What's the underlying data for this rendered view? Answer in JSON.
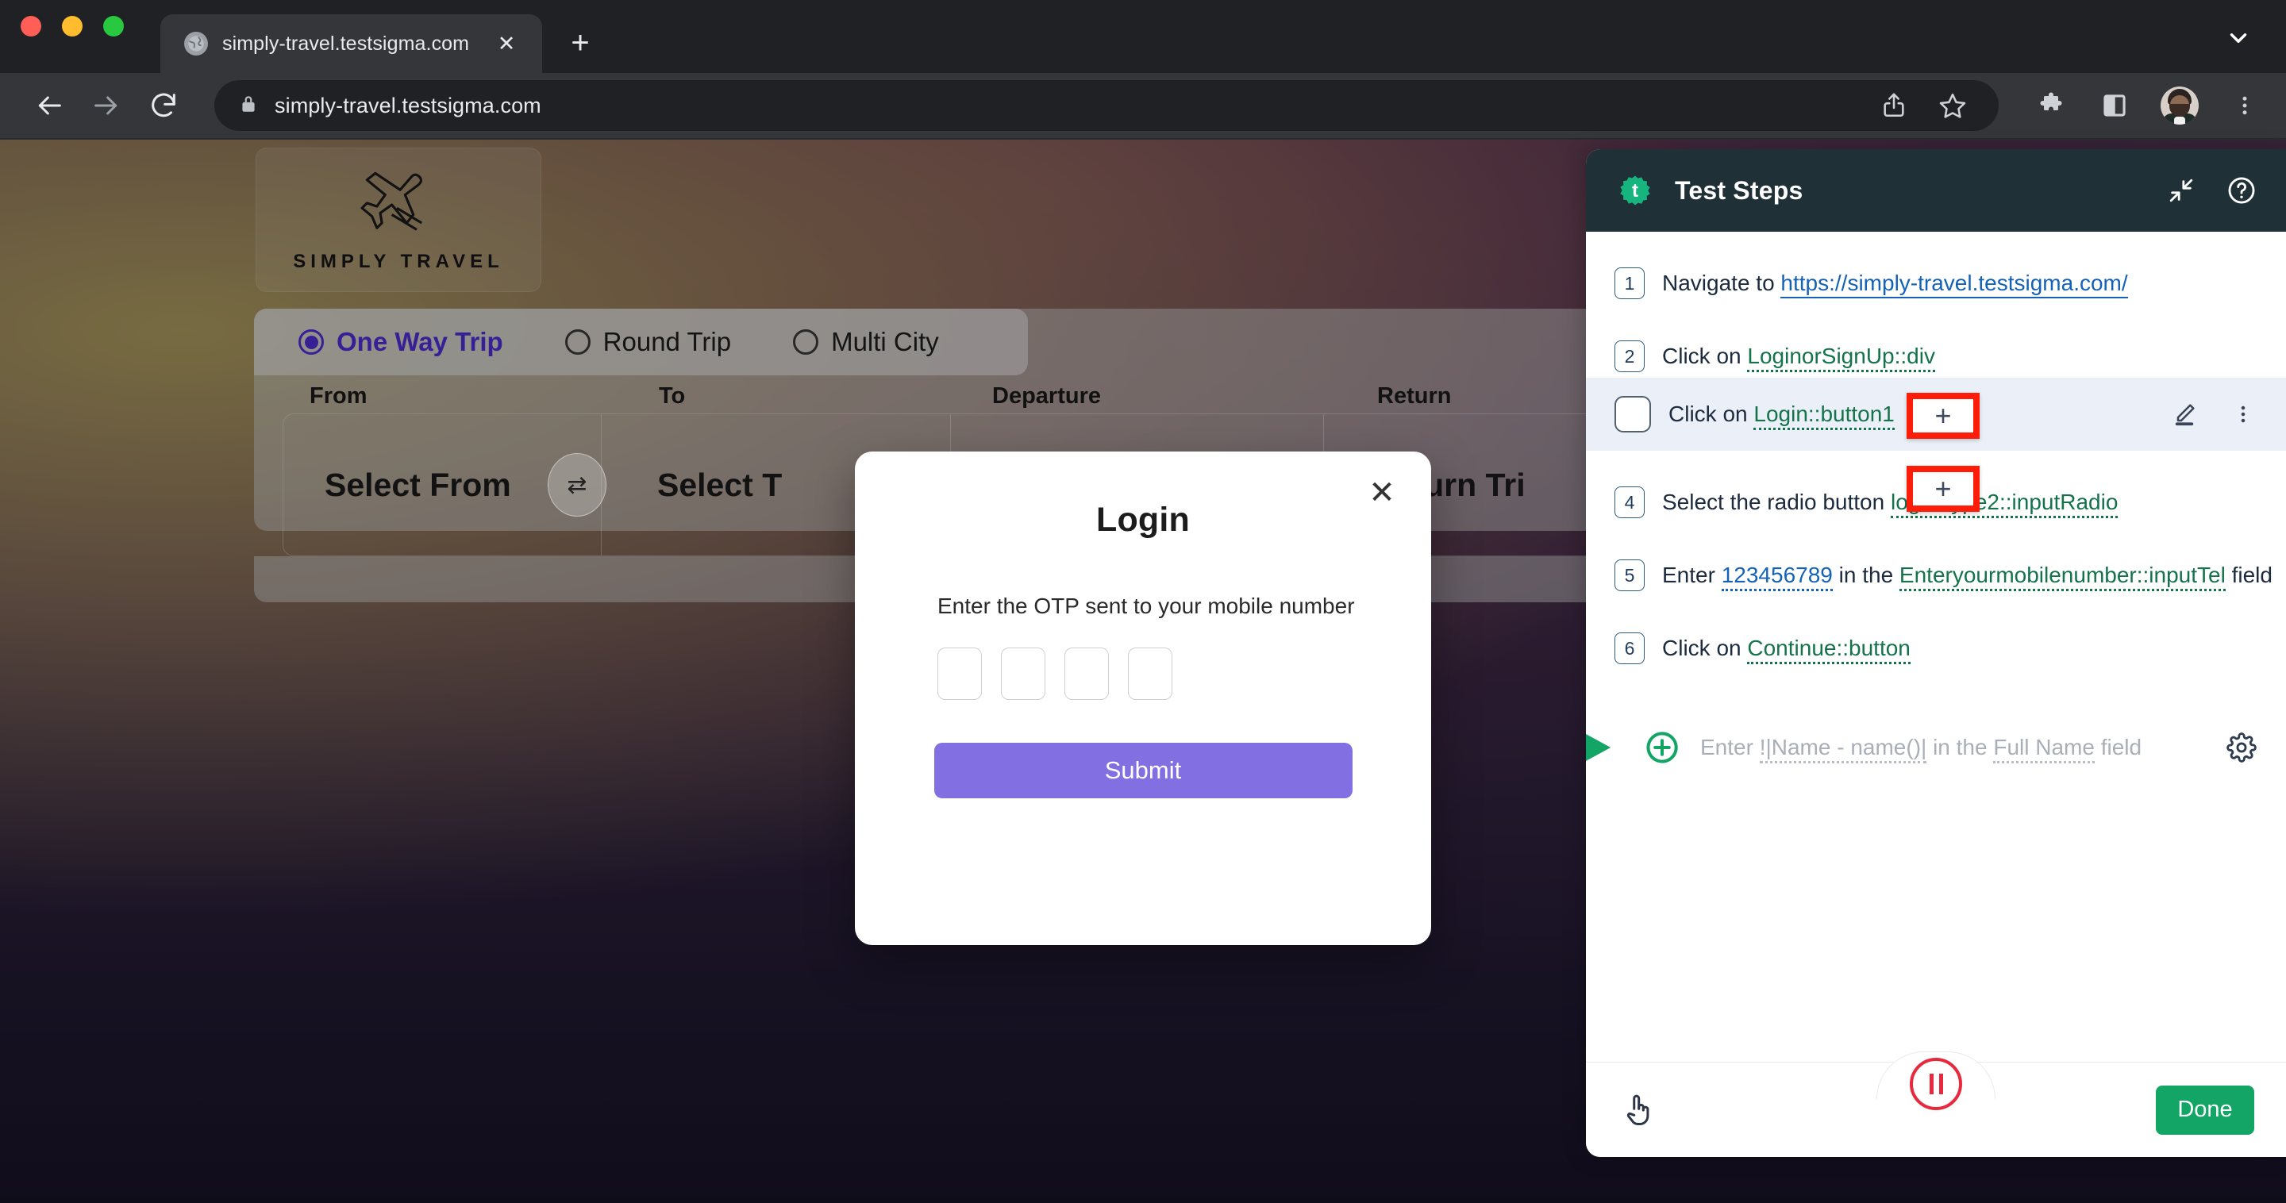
{
  "browser": {
    "tab": {
      "title": "simply-travel.testsigma.com",
      "favicon": "globe-icon",
      "close": "✕"
    },
    "new_tab": "+",
    "tab_list_chevron": "chevron-down-icon",
    "omnibox": {
      "url": "simply-travel.testsigma.com",
      "lock": "lock-icon"
    },
    "actions": [
      "share-icon",
      "bookmark-star-icon",
      "extensions-puzzle-icon",
      "side-panel-icon",
      "profile-avatar",
      "chrome-menu-icon"
    ]
  },
  "page": {
    "logo": {
      "text": "SIMPLY TRAVEL",
      "icon": "airplane-icon"
    },
    "trip_types": [
      {
        "label": "One Way Trip",
        "selected": true
      },
      {
        "label": "Round Trip",
        "selected": false
      },
      {
        "label": "Multi City",
        "selected": false
      }
    ],
    "field_headers": {
      "from": "From",
      "to": "To",
      "departure": "Departure",
      "return": "Return"
    },
    "fields": {
      "from": "Select From",
      "to": "Select T",
      "departure": "",
      "return": "Return Tri"
    },
    "swap_icon": "⇄",
    "accent": "#4f2fd7"
  },
  "modal": {
    "title": "Login",
    "close": "✕",
    "otp_label": "Enter the OTP sent to your mobile number",
    "otp_boxes": [
      "",
      "",
      "",
      ""
    ],
    "submit_label": "Submit",
    "submit_color": "#8270e3"
  },
  "test_steps": {
    "header": {
      "title": "Test Steps",
      "logo": "testsigma-logo-icon",
      "collapse_icon": "collapse-arrows-icon",
      "help_icon": "help-circle-icon"
    },
    "steps": [
      {
        "num": "1",
        "prefix": "Navigate to ",
        "link": "https://simply-travel.testsigma.com/",
        "link_style": "blue-solid",
        "suffix": ""
      },
      {
        "num": "2",
        "prefix": "Click on ",
        "link": "LoginorSignUp::div",
        "link_style": "green",
        "suffix": ""
      },
      {
        "num": "",
        "checkbox": true,
        "prefix": "Click on ",
        "link": "Login::button1",
        "link_style": "green",
        "suffix": "",
        "hovered": true,
        "edit_icon": "pencil-edit-icon",
        "more_icon": "more-vertical-icon"
      },
      {
        "num": "4",
        "prefix": "Select the radio button ",
        "link": "logInType2::inputRadio",
        "link_style": "green",
        "suffix": ""
      },
      {
        "num": "5",
        "prefix": "Enter ",
        "link": "123456789",
        "link_style": "blue",
        "mid": " in the ",
        "link2": "Enteryourmobilenumber::inputTel",
        "suffix": " field"
      },
      {
        "num": "6",
        "prefix": "Click on ",
        "link": "Continue::button",
        "link_style": "green",
        "suffix": ""
      }
    ],
    "add_badges": [
      {
        "label": "+",
        "border_color": "#fd1d08"
      },
      {
        "label": "+",
        "border_color": "#fd1d08"
      }
    ],
    "new_step": {
      "arrow_icon": "play-triangle-icon",
      "plus_icon": "circle-plus-icon",
      "prefix": "Enter ",
      "token1": "!|Name - name()|",
      "mid": " in the ",
      "token2": "Full Name",
      "suffix": " field",
      "gear_icon": "gear-settings-icon"
    },
    "footer": {
      "hand_icon": "pointing-hand-icon",
      "pause_icon": "pause-record-icon",
      "done_label": "Done",
      "done_color": "#13a565"
    }
  }
}
